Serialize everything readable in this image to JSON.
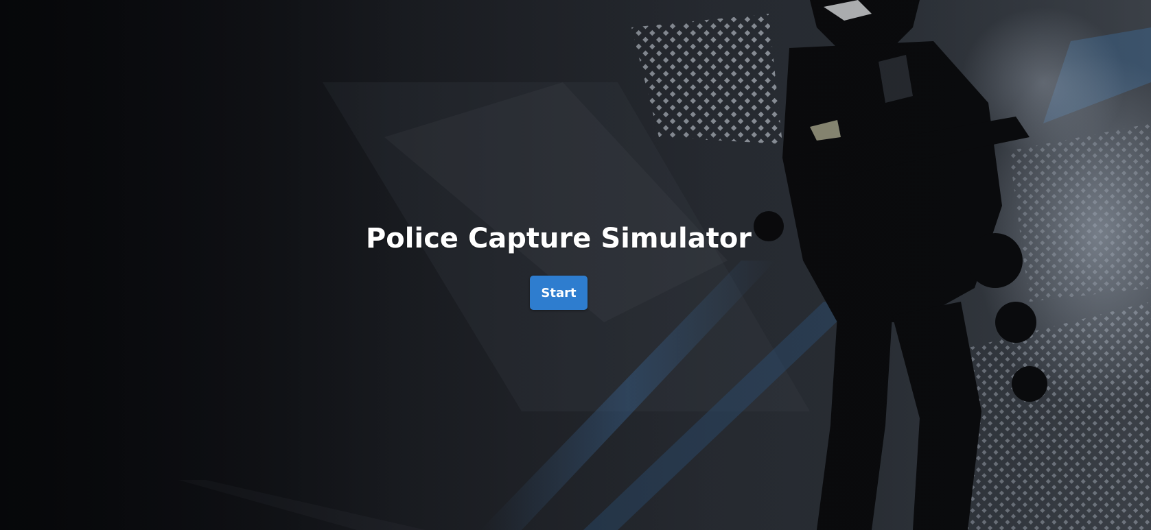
{
  "page": {
    "title": "Police Capture Simulator",
    "start_label": "Start"
  },
  "colors": {
    "button_bg": "#2e7dcf",
    "title_text": "#ffffff",
    "background": "#1c1f25"
  },
  "background_art": {
    "subject": "silhouette of armed police officer in dark grunge style",
    "accent": "#3e6a9a"
  }
}
